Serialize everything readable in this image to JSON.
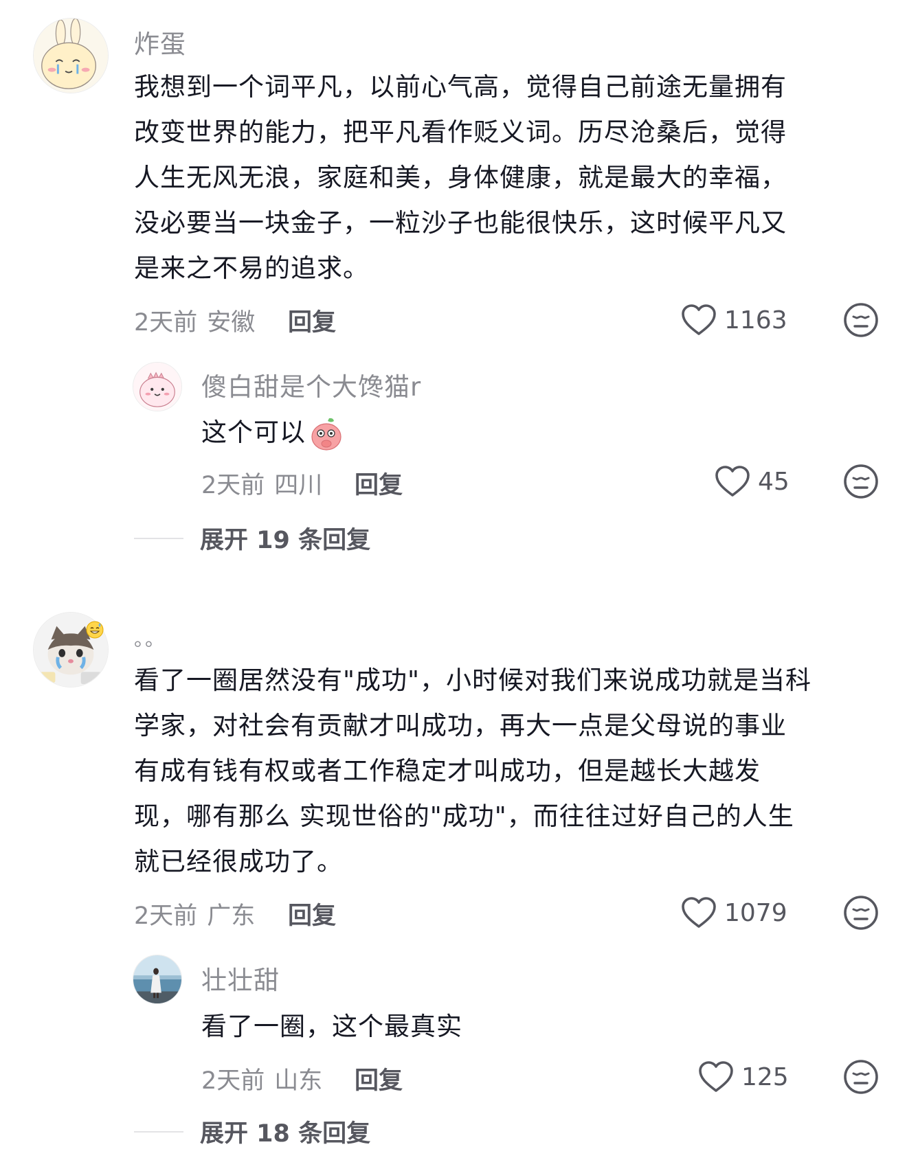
{
  "comments": [
    {
      "author": "炸蛋",
      "text": "我想到一个词平凡，以前心气高，觉得自己前途无量拥有改变世界的能力，把平凡看作贬义词。历尽沧桑后，觉得人生无风无浪，家庭和美，身体健康，就是最大的幸福，没必要当一块金子，一粒沙子也能很快乐，这时候平凡又是来之不易的追求。",
      "lines": [
        "我想到一个词平凡，以前心气高，觉得自己前途无量拥有",
        "改变世界的能力，把平凡看作贬义词。历尽沧桑后，觉得",
        "人生无风无浪，家庭和美，身体健康，就是最大的幸福，",
        "没必要当一块金子，一粒沙子也能很快乐，这时候平凡又",
        "是来之不易的追求。"
      ],
      "time": "2天前",
      "location": "安徽",
      "reply_label": "回复",
      "likes": "1163",
      "reply": {
        "author": "傻白甜是个大馋猫r",
        "text": "这个可以",
        "time": "2天前",
        "location": "四川",
        "reply_label": "回复",
        "likes": "45"
      },
      "expand_label": "展开 19 条回复"
    },
    {
      "author": "。。",
      "lines": [
        "看了一圈居然没有\"成功\"，小时候对我们来说成功就是当科",
        "学家，对社会有贡献才叫成功，再大一点是父母说的事业",
        "有成有钱有权或者工作稳定才叫成功，但是越长大越发",
        "现，哪有那么 实现世俗的\"成功\"，而往往过好自己的人生",
        "就已经很成功了。"
      ],
      "time": "2天前",
      "location": "广东",
      "reply_label": "回复",
      "likes": "1079",
      "reply": {
        "author": "壮壮甜",
        "text": "看了一圈，这个最真实",
        "time": "2天前",
        "location": "山东",
        "reply_label": "回复",
        "likes": "125"
      },
      "expand_label": "展开 18 条回复"
    }
  ],
  "icons": {
    "like": "heart-outline-icon",
    "dislike": "neutral-face-icon"
  },
  "colors": {
    "text": "#161823",
    "secondary": "#8a8b91",
    "action": "#56575f"
  }
}
